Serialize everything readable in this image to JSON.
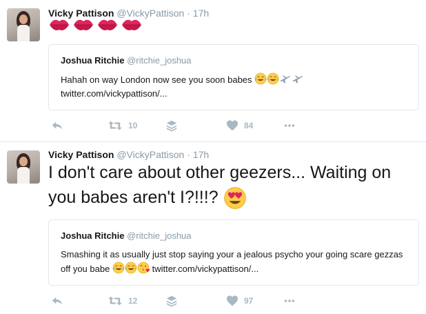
{
  "tweets": [
    {
      "author_name": "Vicky Pattison",
      "author_handle": "@VickyPattison",
      "time": "· 17h",
      "body_text": "",
      "body_icons": [
        "kiss-mark-icon",
        "kiss-mark-icon",
        "kiss-mark-icon",
        "kiss-mark-icon"
      ],
      "quote": {
        "author_name": "Joshua Ritchie",
        "author_handle": "@ritchie_joshua",
        "text": "Hahah on way London now see you soon babes",
        "text_icons": [
          "tears-of-joy-icon",
          "tears-of-joy-icon",
          "airplane-icon",
          "airplane-icon"
        ],
        "link": "twitter.com/vickypattison/..."
      },
      "retweet_count": "10",
      "like_count": "84"
    },
    {
      "author_name": "Vicky Pattison",
      "author_handle": "@VickyPattison",
      "time": "· 17h",
      "body_text": "I don't care about other geezers... Waiting on you babes aren't I?!!!?",
      "body_icons": [
        "heart-eyes-icon"
      ],
      "quote": {
        "author_name": "Joshua Ritchie",
        "author_handle": "@ritchie_joshua",
        "text": "Smashing it as usually just stop saying your a jealous psycho your going scare gezzas off you babe",
        "text_icons": [
          "tears-of-joy-icon",
          "tears-of-joy-icon",
          "face-blowing-kiss-icon"
        ],
        "link": "twitter.com/vickypattison/..."
      },
      "retweet_count": "12",
      "like_count": "97"
    }
  ],
  "colors": {
    "text": "#14171a",
    "muted": "#8899a6",
    "action": "#aab8c2",
    "border": "#e1e8ed"
  }
}
